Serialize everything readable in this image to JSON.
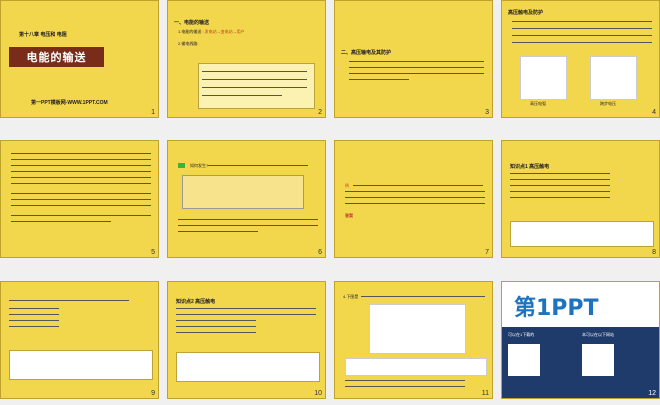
{
  "slides": [
    {
      "num": "1",
      "header": "第十八章 电压和 电阻",
      "title": "电能的输送",
      "subtitle": "第一PPT模板网-WWW.1PPT.COM"
    },
    {
      "num": "2",
      "heading1": "一、电能的输送",
      "line1": "1.电能的输送 : ",
      "line2": "2.输电线路: ",
      "red1": "发电站",
      "red2": "变电站",
      "red3": "用户"
    },
    {
      "num": "3",
      "heading": "二、高压输电及其防护",
      "line1": "高压输电",
      "line2": "跨步电压"
    },
    {
      "num": "4",
      "heading": "高压触电及防护",
      "label1": "高压电弧",
      "label2": "跨步电压"
    },
    {
      "num": "5"
    },
    {
      "num": "6",
      "q": "如何发生?",
      "caption": "高压线路"
    },
    {
      "num": "7",
      "key": "答案",
      "label": "例"
    },
    {
      "num": "8",
      "heading": "知识点1 高压触电"
    },
    {
      "num": "9"
    },
    {
      "num": "10",
      "heading": "知识点2 高压触电"
    },
    {
      "num": "11",
      "caption": "4.下图是"
    },
    {
      "num": "12",
      "brand": "第1PPT",
      "promo": "可以在1下载的",
      "promo2": "本可以在以下网站"
    }
  ]
}
